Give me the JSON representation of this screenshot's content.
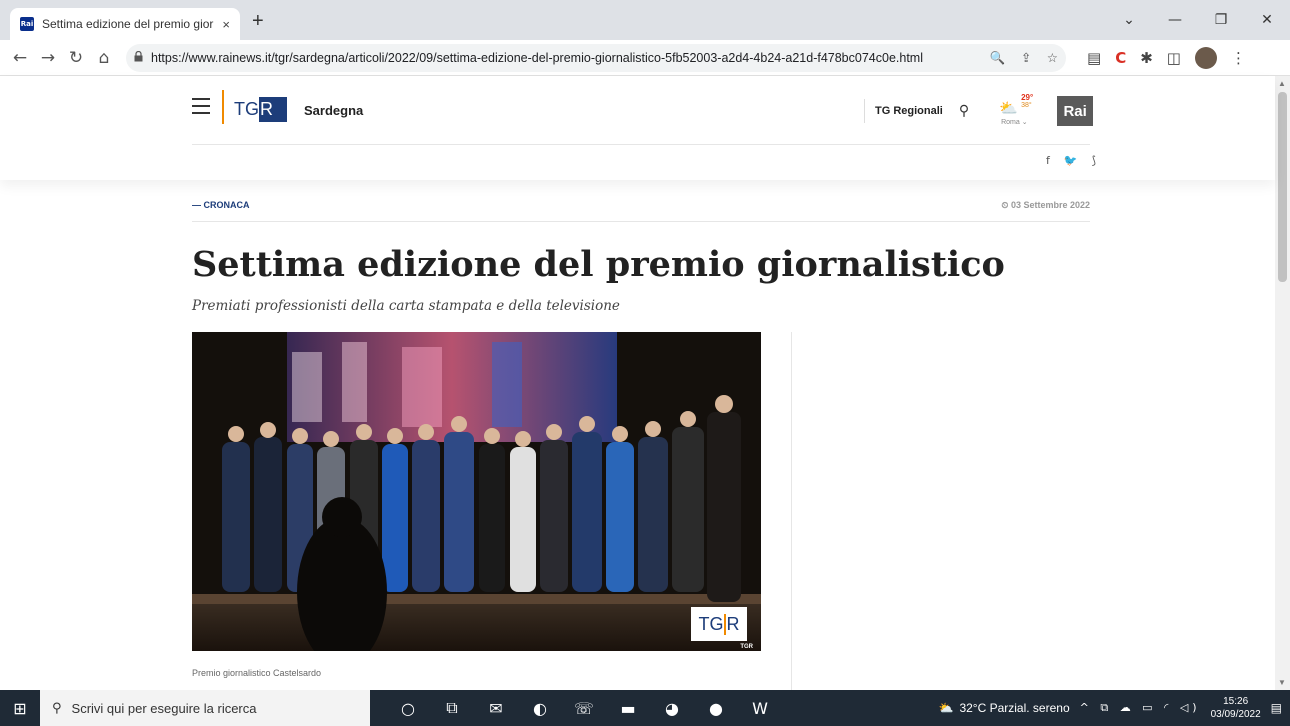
{
  "browser": {
    "tab_title": "Settima edizione del premio gior",
    "tab_favicon": "Rai",
    "tab_close": "×",
    "new_tab": "+",
    "window_controls": {
      "dropdown": "⌄",
      "minimize": "—",
      "restore": "❐",
      "close": "✕"
    },
    "nav": {
      "back": "←",
      "forward": "→",
      "reload": "↻",
      "home": "⌂"
    },
    "url_prefix": "https://",
    "url_host": "www.rainews.it",
    "url_path": "/tgr/sardegna/articoli/2022/09/settima-edizione-del-premio-giornalistico-5fb52003-a2d4-4b24-a21d-f478bc074c0e.html",
    "omnibox_icons": {
      "zoom": "🔍",
      "share": "⇪",
      "bookmark": "☆"
    },
    "extensions": {
      "reading": "▤",
      "ext": "C",
      "puzzle": "✱",
      "sidepanel": "◫",
      "menu": "⋮"
    }
  },
  "site": {
    "logo_tg": "TG",
    "logo_r": "R",
    "region": "Sardegna",
    "tg_regionali": "TG Regionali",
    "search_icon": "⚲",
    "weather": {
      "icon": "⛅",
      "max": "29°",
      "min": "38°",
      "city": "Roma ⌄"
    },
    "rai_logo": "Rai",
    "social": {
      "facebook": "f",
      "twitter": "🐦",
      "rss": "⟆"
    }
  },
  "article": {
    "category": "— CRONACA",
    "date": "⏲ 03 Settembre 2022",
    "title": "Settima edizione del premio giornalistico",
    "subtitle": "Premiati professionisti della carta stampata e della televisione",
    "image_watermark_tg": "TG",
    "image_watermark_r": "R",
    "image_watermark_small": "TGR",
    "caption": "Premio giornalistico Castelsardo"
  },
  "taskbar": {
    "start_icon": "⊞",
    "search_placeholder": "Scrivi qui per eseguire la ricerca",
    "search_icon": "⚲",
    "apps": [
      "○",
      "⧉",
      "✉",
      "◐",
      "☏",
      "▬",
      "◕",
      "●",
      "W"
    ],
    "weather_icon": "⛅",
    "weather_text": "32°C  Parzial. sereno",
    "sys_icons": "^ ⧉ ☁ ▭ ◜ ◁)",
    "time": "15:26",
    "date": "03/09/2022",
    "notif": "▤"
  }
}
